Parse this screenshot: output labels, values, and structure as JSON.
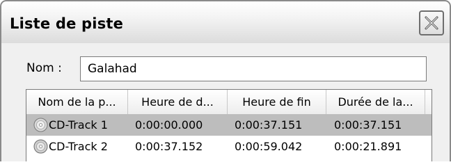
{
  "window": {
    "title": "Liste de piste",
    "close_icon": "close-icon"
  },
  "form": {
    "name_label": "Nom :",
    "name_value": "Galahad"
  },
  "list": {
    "columns": [
      "Nom de la p...",
      "Heure de d...",
      "Heure de fin",
      "Durée de la..."
    ],
    "rows": [
      {
        "icon": "cd-icon",
        "name": "CD-Track 1",
        "start": "0:00:00.000",
        "end": "0:00:37.151",
        "duration": "0:00:37.151",
        "selected": true
      },
      {
        "icon": "cd-icon",
        "name": "CD-Track 2",
        "start": "0:00:37.152",
        "end": "0:00:59.042",
        "duration": "0:00:21.891",
        "selected": false
      }
    ]
  },
  "colors": {
    "selection": "#bdbdbd",
    "frame": "#8a8a8a",
    "client_bg": "#f0f0f0"
  }
}
